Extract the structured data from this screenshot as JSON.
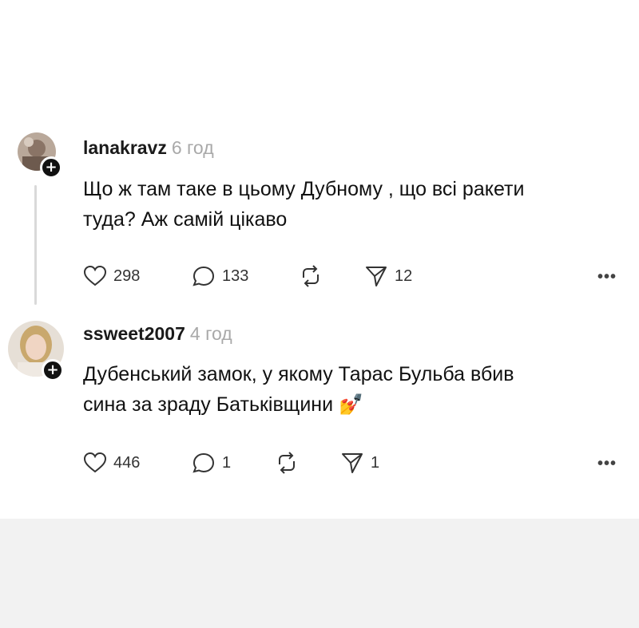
{
  "posts": [
    {
      "username": "lanakravz",
      "time": "6 год",
      "text_lines": [
        "Що ж там таке в цьому Дубному , що всі ракети",
        "туда? Аж самій цікаво"
      ],
      "likes": "298",
      "replies": "133",
      "reposts": "",
      "shares": "12"
    },
    {
      "username": "ssweet2007",
      "time": "4 год",
      "text_lines": [
        "Дубенський замок, у якому Тарас Бульба вбив",
        "сина за зраду Батьківщини 💅"
      ],
      "likes": "446",
      "replies": "1",
      "reposts": "",
      "shares": "1"
    }
  ],
  "icons": {
    "like": "heart-icon",
    "reply": "comment-icon",
    "repost": "repost-icon",
    "share": "send-icon",
    "more": "more-icon",
    "follow": "plus-icon"
  },
  "more_label": "•••",
  "follow_label": "+"
}
